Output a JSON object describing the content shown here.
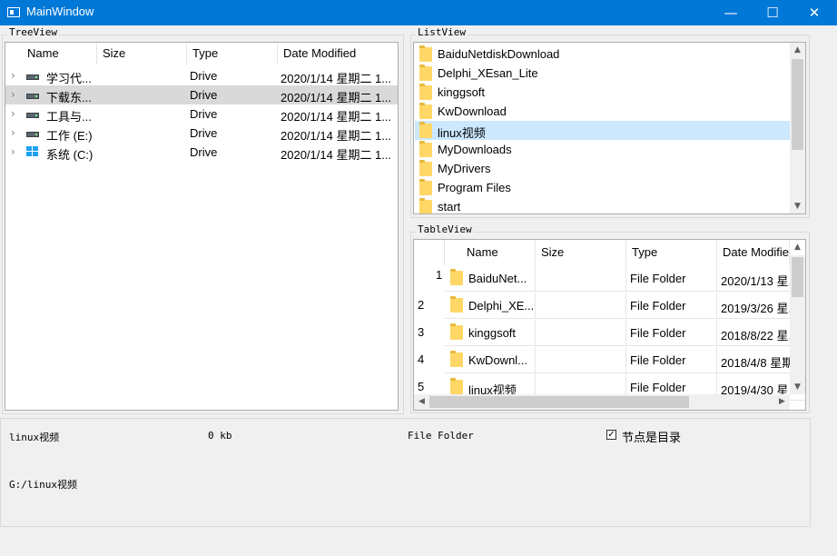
{
  "window": {
    "title": "MainWindow",
    "minimize": "—",
    "maximize": "☐",
    "close": "✕"
  },
  "tree_view": {
    "title": "TreeView",
    "columns": [
      "Name",
      "Size",
      "Type",
      "Date Modified"
    ],
    "rows": [
      {
        "name": "学习代...",
        "size": "",
        "type": "Drive",
        "date": "2020/1/14 星期二 1...",
        "icon": "drive-icon",
        "selected": false
      },
      {
        "name": "下载东...",
        "size": "",
        "type": "Drive",
        "date": "2020/1/14 星期二 1...",
        "icon": "drive-icon",
        "selected": true
      },
      {
        "name": "工具与...",
        "size": "",
        "type": "Drive",
        "date": "2020/1/14 星期二 1...",
        "icon": "drive-icon",
        "selected": false
      },
      {
        "name": "工作 (E:)",
        "size": "",
        "type": "Drive",
        "date": "2020/1/14 星期二 1...",
        "icon": "drive-icon",
        "selected": false
      },
      {
        "name": "系统 (C:)",
        "size": "",
        "type": "Drive",
        "date": "2020/1/14 星期二 1...",
        "icon": "windows-drive-icon",
        "selected": false
      }
    ]
  },
  "list_view": {
    "title": "ListView",
    "items": [
      {
        "label": "BaiduNetdiskDownload",
        "selected": false
      },
      {
        "label": "Delphi_XEsan_Lite",
        "selected": false
      },
      {
        "label": "kinggsoft",
        "selected": false
      },
      {
        "label": "KwDownload",
        "selected": false
      },
      {
        "label": "linux视频",
        "selected": true
      },
      {
        "label": "MyDownloads",
        "selected": false
      },
      {
        "label": "MyDrivers",
        "selected": false
      },
      {
        "label": "Program Files",
        "selected": false
      },
      {
        "label": "start",
        "selected": false
      }
    ]
  },
  "table_view": {
    "title": "TableView",
    "columns": [
      "Name",
      "Size",
      "Type",
      "Date Modifie"
    ],
    "rows": [
      {
        "num": "1",
        "name": "BaiduNet...",
        "size": "",
        "type": "File Folder",
        "date": "2020/1/13 星."
      },
      {
        "num": "2",
        "name": "Delphi_XE...",
        "size": "",
        "type": "File Folder",
        "date": "2019/3/26 星."
      },
      {
        "num": "3",
        "name": "kinggsoft",
        "size": "",
        "type": "File Folder",
        "date": "2018/8/22 星."
      },
      {
        "num": "4",
        "name": "KwDownl...",
        "size": "",
        "type": "File Folder",
        "date": "2018/4/8 星期"
      },
      {
        "num": "5",
        "name": "linux视频",
        "size": "",
        "type": "File Folder",
        "date": "2019/4/30 星"
      }
    ]
  },
  "status": {
    "name": "linux视频",
    "size": "0 kb",
    "type": "File Folder",
    "checkbox_label": "节点是目录",
    "checkbox_checked": "✓",
    "path": "G:/linux视频"
  },
  "colors": {
    "titlebar": "#0078d7",
    "selection": "#cce8ff",
    "tree_selection": "#d9d9d9"
  }
}
